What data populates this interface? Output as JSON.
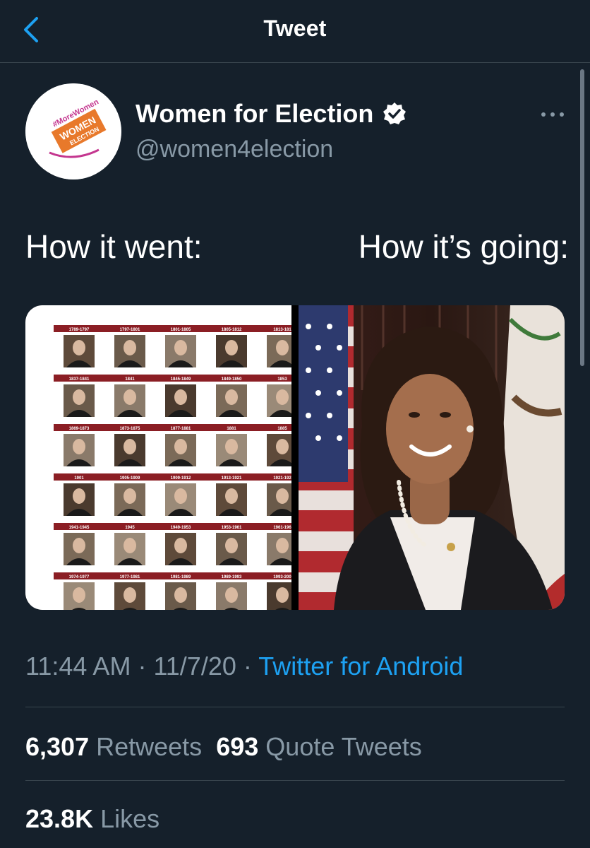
{
  "header": {
    "title": "Tweet"
  },
  "author": {
    "display_name": "Women for Election",
    "handle": "@women4election",
    "logo_tag": "#MoreWomen",
    "logo_word1": "WOMEN",
    "logo_word2": "ELECTION"
  },
  "tweet": {
    "text_left": "How it went:",
    "text_right": "How it’s going:"
  },
  "president_grid": [
    [
      "1789-1797",
      "1797-1801",
      "1801-1805",
      "1805-1812",
      "1813-181"
    ],
    [
      "1837-1841",
      "1841",
      "1845-1849",
      "1849-1850",
      "1853"
    ],
    [
      "1869-1873",
      "1873-1875",
      "1877-1881",
      "1881",
      "1885"
    ],
    [
      "1901",
      "1905-1909",
      "1909-1912",
      "1913-1921",
      "1921-192"
    ],
    [
      "1941-1945",
      "1945",
      "1949-1953",
      "1953-1961",
      "1961-196"
    ],
    [
      "1974-1977",
      "1977-1981",
      "1981-1989",
      "1989-1993",
      "1993-200"
    ]
  ],
  "meta": {
    "time": "11:44 AM",
    "sep1": " · ",
    "date": "11/7/20",
    "sep2": " · ",
    "source": "Twitter for Android"
  },
  "stats": {
    "retweets_count": "6,307",
    "retweets_label": "Retweets",
    "quotes_count": "693",
    "quotes_label": "Quote Tweets",
    "likes_count": "23.8K",
    "likes_label": "Likes"
  },
  "colors": {
    "background": "#15202b",
    "accent": "#1da1f2",
    "secondary_text": "#8899a6",
    "divider": "#38444d"
  }
}
